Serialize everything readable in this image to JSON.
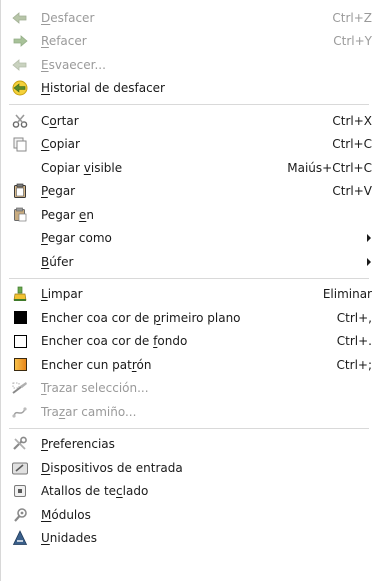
{
  "menu": {
    "items": [
      {
        "id": "undo",
        "prefix": "",
        "key": "D",
        "rest": "esfacer",
        "shortcut": "Ctrl+Z",
        "disabled": true,
        "icon": "undo-arrow-icon"
      },
      {
        "id": "redo",
        "prefix": "",
        "key": "R",
        "rest": "efacer",
        "shortcut": "Ctrl+Y",
        "disabled": true,
        "icon": "redo-arrow-icon"
      },
      {
        "id": "fade",
        "prefix": "",
        "key": "E",
        "rest": "svaecer...",
        "shortcut": "",
        "disabled": true,
        "icon": "fade-arrow-icon"
      },
      {
        "id": "undo-history",
        "prefix": "",
        "key": "H",
        "rest": "istorial de desfacer",
        "shortcut": "",
        "disabled": false,
        "icon": "undo-history-icon"
      },
      {
        "sep": true
      },
      {
        "id": "cut",
        "prefix": "C",
        "key": "o",
        "rest": "rtar",
        "shortcut": "Ctrl+X",
        "disabled": false,
        "icon": "scissors-icon"
      },
      {
        "id": "copy",
        "prefix": "",
        "key": "C",
        "rest": "opiar",
        "shortcut": "Ctrl+C",
        "disabled": false,
        "icon": "copy-icon"
      },
      {
        "id": "copy-visible",
        "prefix": "Copiar ",
        "key": "v",
        "rest": "isible",
        "shortcut": "Maiús+Ctrl+C",
        "disabled": false,
        "icon": ""
      },
      {
        "id": "paste",
        "prefix": "",
        "key": "P",
        "rest": "egar",
        "shortcut": "Ctrl+V",
        "disabled": false,
        "icon": "paste-icon"
      },
      {
        "id": "paste-into",
        "prefix": "Pegar ",
        "key": "e",
        "rest": "n",
        "shortcut": "",
        "disabled": false,
        "icon": "paste-into-icon"
      },
      {
        "id": "paste-as",
        "prefix": "",
        "key": "P",
        "rest": "egar como",
        "shortcut": "",
        "disabled": false,
        "icon": "",
        "submenu": true
      },
      {
        "id": "buffer",
        "prefix": "",
        "key": "B",
        "rest": "úfer",
        "shortcut": "",
        "disabled": false,
        "icon": "",
        "submenu": true
      },
      {
        "sep": true
      },
      {
        "id": "clear",
        "prefix": "",
        "key": "L",
        "rest": "impar",
        "shortcut": "Eliminar",
        "disabled": false,
        "icon": "eraser-icon"
      },
      {
        "id": "fill-fg",
        "prefix": "Encher coa cor de ",
        "key": "p",
        "rest": "rimeiro plano",
        "shortcut": "Ctrl+,",
        "disabled": false,
        "icon": "foreground-swatch-icon"
      },
      {
        "id": "fill-bg",
        "prefix": "Encher coa cor de ",
        "key": "f",
        "rest": "ondo",
        "shortcut": "Ctrl+.",
        "disabled": false,
        "icon": "background-swatch-icon"
      },
      {
        "id": "fill-pattern",
        "prefix": "Encher cun pat",
        "key": "r",
        "rest": "ón",
        "shortcut": "Ctrl+;",
        "disabled": false,
        "icon": "pattern-swatch-icon"
      },
      {
        "id": "stroke-selection",
        "prefix": "",
        "key": "T",
        "rest": "razar selección...",
        "shortcut": "",
        "disabled": true,
        "icon": "stroke-selection-icon"
      },
      {
        "id": "stroke-path",
        "prefix": "Tra",
        "key": "z",
        "rest": "ar camiño...",
        "shortcut": "",
        "disabled": true,
        "icon": "stroke-path-icon"
      },
      {
        "sep": true
      },
      {
        "id": "preferences",
        "prefix": "",
        "key": "P",
        "rest": "referencias",
        "shortcut": "",
        "disabled": false,
        "icon": "preferences-icon"
      },
      {
        "id": "input-devices",
        "prefix": "",
        "key": "D",
        "rest": "ispositivos de entrada",
        "shortcut": "",
        "disabled": false,
        "icon": "input-devices-icon"
      },
      {
        "id": "keyboard-shortcuts",
        "prefix": "Atallos de te",
        "key": "c",
        "rest": "lado",
        "shortcut": "",
        "disabled": false,
        "icon": "keyboard-icon"
      },
      {
        "id": "modules",
        "prefix": "",
        "key": "M",
        "rest": "ódulos",
        "shortcut": "",
        "disabled": false,
        "icon": "modules-icon"
      },
      {
        "id": "units",
        "prefix": "",
        "key": "U",
        "rest": "nidades",
        "shortcut": "",
        "disabled": false,
        "icon": "units-icon"
      }
    ]
  },
  "colors": {
    "foreground_swatch": "#000000",
    "background_swatch": "#ffffff",
    "pattern_swatch": "#f0a020",
    "disabled_text": "#9a9a9a",
    "separator": "#d9d9d9"
  }
}
